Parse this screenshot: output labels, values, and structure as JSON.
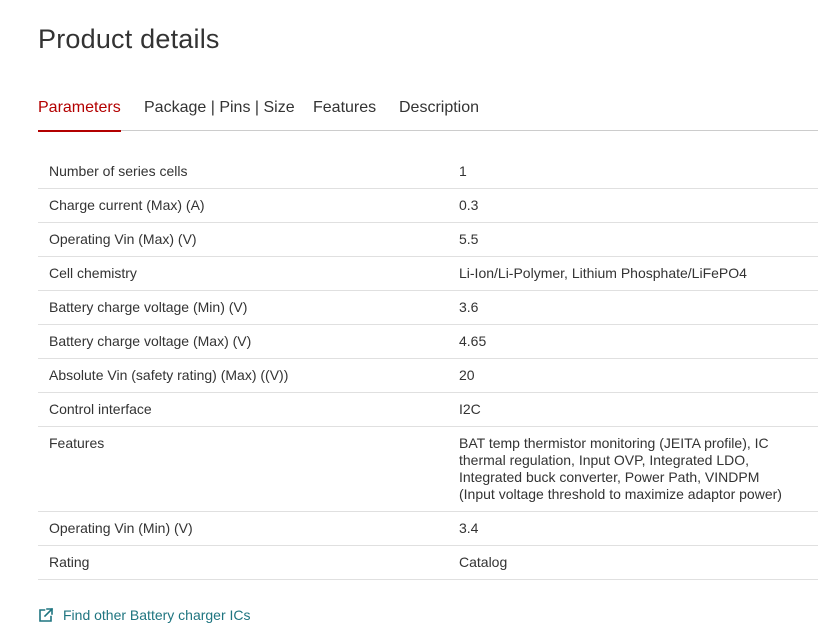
{
  "page": {
    "title": "Product details"
  },
  "tabs": [
    {
      "label": "Parameters",
      "active": true
    },
    {
      "label": "Package | Pins | Size",
      "active": false
    },
    {
      "label": "Features",
      "active": false
    },
    {
      "label": "Description",
      "active": false
    }
  ],
  "parameters": [
    {
      "name": "Number of series cells",
      "value": "1"
    },
    {
      "name": "Charge current (Max) (A)",
      "value": "0.3"
    },
    {
      "name": "Operating Vin (Max) (V)",
      "value": "5.5"
    },
    {
      "name": "Cell chemistry",
      "value": "Li-Ion/Li-Polymer, Lithium Phosphate/LiFePO4"
    },
    {
      "name": "Battery charge voltage (Min) (V)",
      "value": "3.6"
    },
    {
      "name": "Battery charge voltage (Max) (V)",
      "value": "4.65"
    },
    {
      "name": "Absolute Vin (safety rating) (Max) ((V))",
      "value": "20"
    },
    {
      "name": "Control interface",
      "value": "I2C"
    },
    {
      "name": "Features",
      "value": "BAT temp thermistor monitoring (JEITA profile), IC thermal regulation, Input OVP, Integrated LDO, Integrated buck converter, Power Path, VINDPM (Input voltage threshold to maximize adaptor power)"
    },
    {
      "name": "Operating Vin (Min) (V)",
      "value": "3.4"
    },
    {
      "name": "Rating",
      "value": "Catalog"
    }
  ],
  "find_link": {
    "label": "Find other Battery charger ICs",
    "icon": "external-link-icon"
  },
  "colors": {
    "accent": "#b30000",
    "link": "#1f7580",
    "text": "#333333",
    "divider": "#e0e0e0"
  }
}
